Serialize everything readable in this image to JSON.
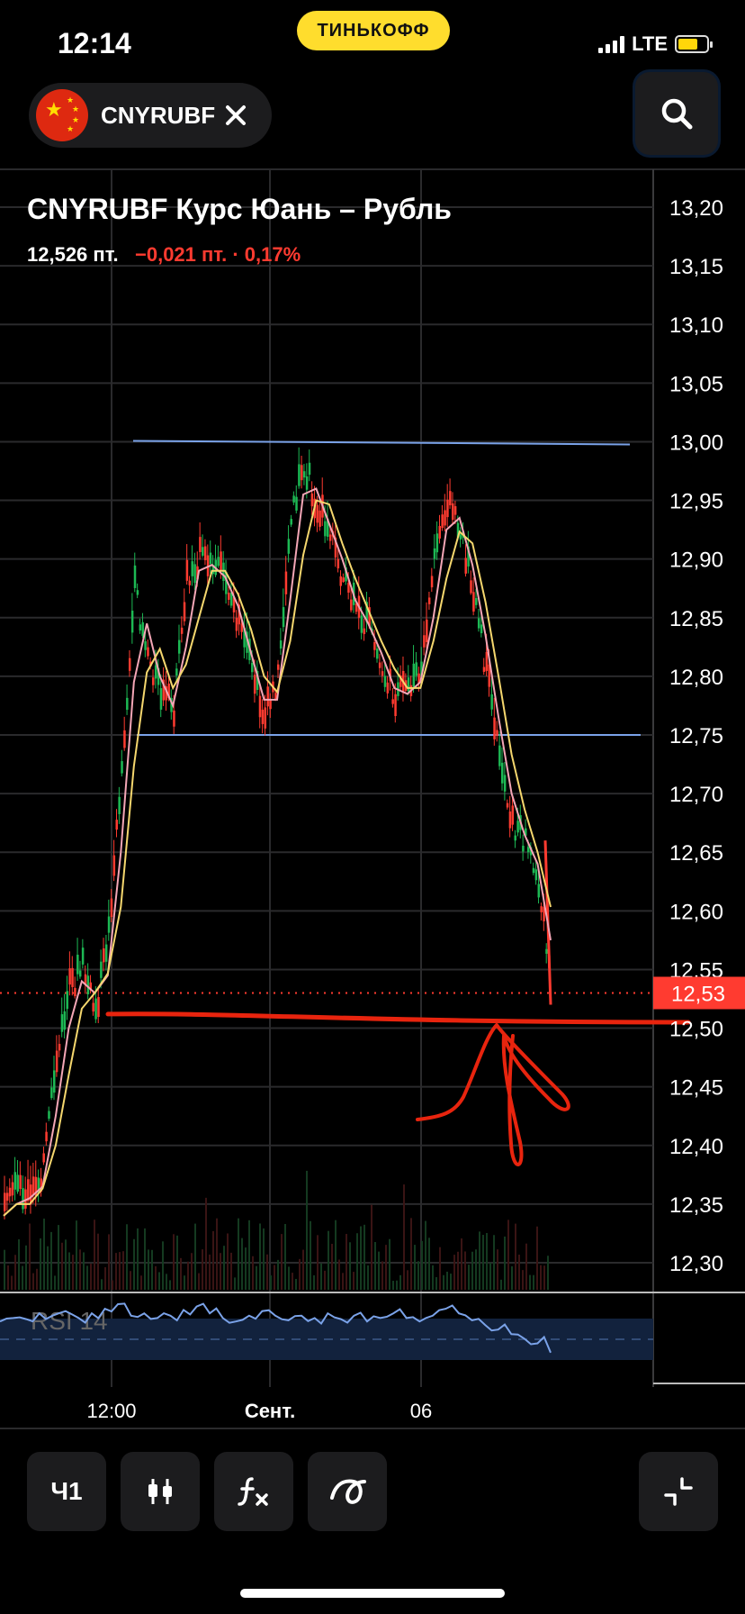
{
  "status_bar": {
    "time": "12:14",
    "broker": "ТИНЬКОФФ",
    "network": "LTE",
    "battery_level": 0.7
  },
  "ticker_chip": {
    "label": "CNYRUBF"
  },
  "chart_header": {
    "title": "CNYRUBF Курс Юань – Рубль",
    "price": "12,526 пт.",
    "change": "−0,021 пт. · 0,17%"
  },
  "colors": {
    "up": "#1db954",
    "down": "#ff3b30",
    "ma_fast": "#f4a6b6",
    "ma_slow": "#f5d76e",
    "hline": "#7aa2e8",
    "rsi": "#7aa2e8",
    "annotation": "#e8240e"
  },
  "chart_data": {
    "type": "line",
    "y_ticks": [
      "13,20",
      "13,15",
      "13,10",
      "13,05",
      "13,00",
      "12,95",
      "12,90",
      "12,85",
      "12,80",
      "12,75",
      "12,70",
      "12,65",
      "12,60",
      "12,55",
      "12,50",
      "12,45",
      "12,40",
      "12,35",
      "12,30"
    ],
    "ylim": [
      12.27,
      13.22
    ],
    "x_ticks": [
      "12:00",
      "Сент.",
      "06"
    ],
    "current_price_label": "12,53",
    "current_price": 12.53,
    "horizontal_levels": [
      13.0,
      12.75,
      12.51
    ],
    "series": [
      {
        "values": [
          12.34,
          12.36,
          12.35,
          12.38,
          12.47,
          12.53,
          12.55,
          12.51,
          12.58,
          12.72,
          12.87,
          12.82,
          12.78,
          12.77,
          12.88,
          12.9,
          12.89,
          12.88,
          12.84,
          12.8,
          12.76,
          12.8,
          12.93,
          12.98,
          12.94,
          12.92,
          12.88,
          12.85,
          12.84,
          12.8,
          12.78,
          12.79,
          12.8,
          12.9,
          12.95,
          12.92,
          12.87,
          12.8,
          12.73,
          12.67,
          12.66,
          12.62,
          12.53
        ]
      }
    ],
    "rsi": {
      "label": "RSI 14",
      "values": [
        55,
        58,
        57,
        62,
        60,
        64,
        58,
        62,
        66,
        70,
        60,
        62,
        58,
        60,
        65,
        68,
        62,
        58,
        55,
        60,
        64,
        60,
        56,
        60,
        58,
        62,
        57,
        60,
        55,
        58,
        62,
        58,
        55,
        60,
        66,
        62,
        56,
        52,
        48,
        44,
        40,
        36,
        28
      ]
    }
  },
  "toolbar": {
    "interval": "Ч1"
  }
}
